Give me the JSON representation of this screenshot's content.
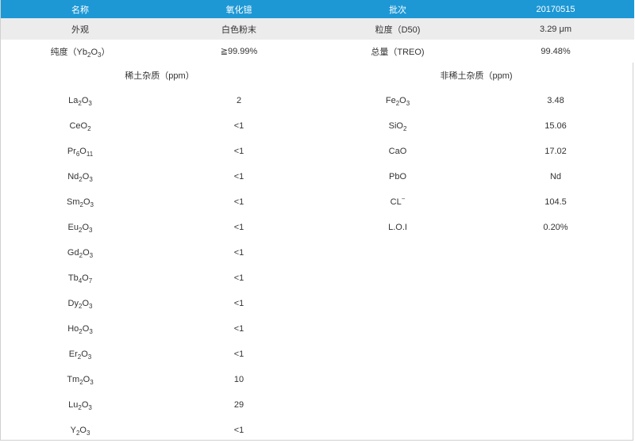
{
  "header": {
    "col1": "名称",
    "col2": "氧化镱",
    "col3": "批次",
    "col4": "20170515"
  },
  "info": [
    {
      "l1": "外观",
      "v1": "白色粉末",
      "l2": "粒度（D50)",
      "v2": "3.29 μm"
    },
    {
      "l1": "纯度（Yb2O3）",
      "v1": "≧99.99%",
      "l2": "总量（TREO)",
      "v2": "99.48%"
    }
  ],
  "sections": {
    "rare_earth": "稀土杂质（ppm）",
    "non_rare_earth": "非稀土杂质（ppm)"
  },
  "rare_earth_impurities": [
    {
      "name": "La2O3",
      "value": "2"
    },
    {
      "name": "CeO2",
      "value": "<1"
    },
    {
      "name": "Pr6O11",
      "value": "<1"
    },
    {
      "name": "Nd2O3",
      "value": "<1"
    },
    {
      "name": "Sm2O3",
      "value": "<1"
    },
    {
      "name": "Eu2O3",
      "value": "<1"
    },
    {
      "name": "Gd2O3",
      "value": "<1"
    },
    {
      "name": "Tb4O7",
      "value": "<1"
    },
    {
      "name": "Dy2O3",
      "value": "<1"
    },
    {
      "name": "Ho2O3",
      "value": "<1"
    },
    {
      "name": "Er2O3",
      "value": "<1"
    },
    {
      "name": "Tm2O3",
      "value": "10"
    },
    {
      "name": "Lu2O3",
      "value": "29"
    },
    {
      "name": "Y2O3",
      "value": "<1"
    }
  ],
  "non_rare_earth_impurities": [
    {
      "name": "Fe2O3",
      "value": "3.48"
    },
    {
      "name": "SiO2",
      "value": "15.06"
    },
    {
      "name": "CaO",
      "value": "17.02"
    },
    {
      "name": "PbO",
      "value": "Nd"
    },
    {
      "name": "CL-",
      "value": "104.5"
    },
    {
      "name": "L.O.I",
      "value": "0.20%"
    }
  ],
  "colors": {
    "header_bg": "#1d98d5",
    "header_text": "#ffffff",
    "stripe": "#ececec",
    "text": "#333333"
  }
}
